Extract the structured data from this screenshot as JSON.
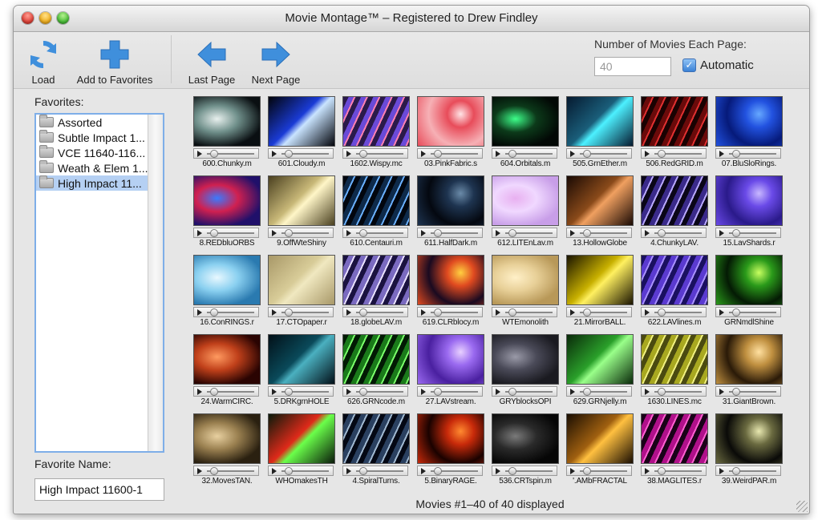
{
  "window": {
    "title": "Movie Montage™ – Registered to Drew Findley"
  },
  "toolbar": {
    "load_label": "Load",
    "add_favorites_label": "Add to Favorites",
    "last_page_label": "Last Page",
    "next_page_label": "Next Page",
    "movies_per_page_label": "Number of Movies Each Page:",
    "movies_per_page_value": "40",
    "automatic_label": "Automatic",
    "automatic_checked": true
  },
  "favorites": {
    "label": "Favorites:",
    "items": [
      {
        "label": "Assorted"
      },
      {
        "label": "Subtle Impact 1..."
      },
      {
        "label": "VCE 11640-116..."
      },
      {
        "label": "Weath & Elem 1..."
      },
      {
        "label": "High Impact 11..."
      }
    ],
    "selected_index": 4,
    "name_label": "Favorite Name:",
    "name_value": "High Impact 11600-1"
  },
  "movies": [
    {
      "caption": "600.Chunky.m",
      "colors": [
        "#0a0f12",
        "#6f8f8a",
        "#e8f0ee"
      ]
    },
    {
      "caption": "601.Cloudy.m",
      "colors": [
        "#02040a",
        "#1a3bd6",
        "#c9e4ff"
      ]
    },
    {
      "caption": "1602.Wispy.mc",
      "colors": [
        "#2a1a4a",
        "#6a4ad8",
        "#ff7fb0"
      ]
    },
    {
      "caption": "03.PinkFabric.s",
      "colors": [
        "#f6b0b5",
        "#e84c5a",
        "#ffe4e6"
      ]
    },
    {
      "caption": "604.Orbitals.m",
      "colors": [
        "#020805",
        "#0c3a1a",
        "#3dff8a"
      ]
    },
    {
      "caption": "505.GrnEther.m",
      "colors": [
        "#061a30",
        "#1a5e7a",
        "#4cf0ff"
      ]
    },
    {
      "caption": "506.RedGRID.m",
      "colors": [
        "#1a0202",
        "#6a0a0a",
        "#e03030"
      ]
    },
    {
      "caption": "07.BluSloRings.",
      "colors": [
        "#061a7a",
        "#2252e0",
        "#66a8ff"
      ]
    },
    {
      "caption": "8.REDbluORBS",
      "colors": [
        "#20106a",
        "#d02050",
        "#3a7aff"
      ]
    },
    {
      "caption": "9.OffWteShiny",
      "colors": [
        "#4a4020",
        "#c8b878",
        "#fff6c8"
      ]
    },
    {
      "caption": "610.Centauri.m",
      "colors": [
        "#02060e",
        "#0e2a4a",
        "#6ab0ff"
      ]
    },
    {
      "caption": "611.HalfDark.m",
      "colors": [
        "#040810",
        "#1e3450",
        "#6a8aa8"
      ]
    },
    {
      "caption": "612.LITEnLav.m",
      "colors": [
        "#c89ee8",
        "#f0d8ff",
        "#e8b0f0"
      ]
    },
    {
      "caption": "13.HollowGlobe",
      "colors": [
        "#1a0a04",
        "#8a4a1a",
        "#f0a060"
      ]
    },
    {
      "caption": "4.ChunkyLAV.",
      "colors": [
        "#0a0618",
        "#3a2a8a",
        "#b8a8ff"
      ]
    },
    {
      "caption": "15.LavShards.r",
      "colors": [
        "#2a1a8a",
        "#6a4ae8",
        "#c8b8ff"
      ]
    },
    {
      "caption": "16.ConRINGS.r",
      "colors": [
        "#2a7ab0",
        "#8ad0f0",
        "#e8f8ff"
      ]
    },
    {
      "caption": "17.CTOpaper.r",
      "colors": [
        "#a89868",
        "#d8cc98",
        "#f0e8c0"
      ]
    },
    {
      "caption": "18.globeLAV.m",
      "colors": [
        "#1a1240",
        "#7a6ac0",
        "#e8e0ff"
      ]
    },
    {
      "caption": "619.CLRblocy.m",
      "colors": [
        "#1a0a20",
        "#e04a20",
        "#ffd040"
      ]
    },
    {
      "caption": "WTEmonolith",
      "colors": [
        "#b89858",
        "#e8d098",
        "#fff0c8"
      ]
    },
    {
      "caption": "21.MirrorBALL.",
      "colors": [
        "#1a1400",
        "#c8b000",
        "#fff060"
      ]
    },
    {
      "caption": "622.LAVlines.m",
      "colors": [
        "#1a1060",
        "#5a3ad0",
        "#a890ff"
      ]
    },
    {
      "caption": "GRNmdlShine",
      "colors": [
        "#041a04",
        "#2a9a1a",
        "#c8ff60"
      ]
    },
    {
      "caption": "24.WarmCIRC.",
      "colors": [
        "#2a0402",
        "#c0401a",
        "#ff9a60"
      ]
    },
    {
      "caption": "5.DRKgrnHOLE",
      "colors": [
        "#021018",
        "#0a4a5a",
        "#4ab0c0"
      ]
    },
    {
      "caption": "626.GRNcode.m",
      "colors": [
        "#021a04",
        "#1a7a1a",
        "#7aff6a"
      ]
    },
    {
      "caption": "27.LAVstream.",
      "colors": [
        "#4a20a0",
        "#9a6af0",
        "#e8d0ff"
      ]
    },
    {
      "caption": "GRYblocksOPI",
      "colors": [
        "#1a1a20",
        "#4a4a58",
        "#9a9aa8"
      ]
    },
    {
      "caption": "629.GRNjelly.m",
      "colors": [
        "#0a2a0a",
        "#2aa02a",
        "#9aff8a"
      ]
    },
    {
      "caption": "1630.LINES.mc",
      "colors": [
        "#4a4a10",
        "#a8a820",
        "#f0f080"
      ]
    },
    {
      "caption": "31.GiantBrown.",
      "colors": [
        "#2a1a08",
        "#c09040",
        "#ffe0a0"
      ]
    },
    {
      "caption": "32.MovesTAN.",
      "colors": [
        "#2a2010",
        "#9a8050",
        "#e8d0a0"
      ]
    },
    {
      "caption": "WHOmakesTH",
      "colors": [
        "#0a1a0a",
        "#e02a1a",
        "#6aff4a"
      ]
    },
    {
      "caption": "4.SpiralTurns.",
      "colors": [
        "#040814",
        "#2a4060",
        "#a0b8d0"
      ]
    },
    {
      "caption": "5.BinaryRAGE.",
      "colors": [
        "#1a0200",
        "#c82a0a",
        "#ff8a30"
      ]
    },
    {
      "caption": "536.CRTspin.m",
      "colors": [
        "#060606",
        "#2a2a2a",
        "#7a7a7a"
      ]
    },
    {
      "caption": "'.AMbFRACTAL",
      "colors": [
        "#1a0e02",
        "#a06010",
        "#ffc040"
      ]
    },
    {
      "caption": "38.MAGLITES.r",
      "colors": [
        "#1a0218",
        "#b0108a",
        "#ff60d0"
      ]
    },
    {
      "caption": "39.WeirdPAR.m",
      "colors": [
        "#0a0a08",
        "#6a6a40",
        "#e8e8b0"
      ]
    }
  ],
  "status": {
    "text": "Movies #1–40 of 40 displayed"
  }
}
